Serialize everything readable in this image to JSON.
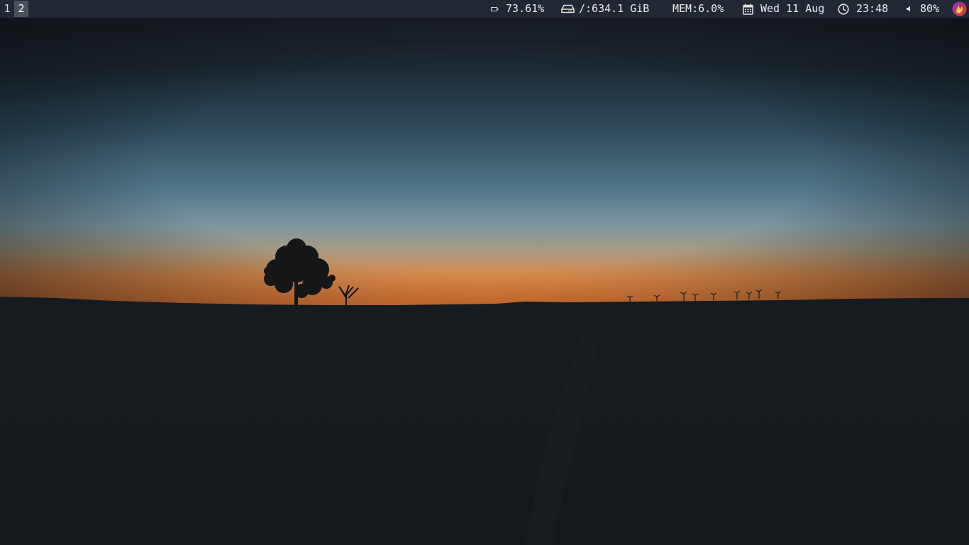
{
  "workspaces": [
    {
      "label": "1",
      "active": false
    },
    {
      "label": "2",
      "active": true
    }
  ],
  "status": {
    "battery": {
      "icon": "battery-icon",
      "value": "73.61%"
    },
    "disk": {
      "icon": "hard-drive-icon",
      "value": "/:634.1 GiB"
    },
    "memory": {
      "value": "MEM:6.0%"
    },
    "date": {
      "icon": "calendar-icon",
      "value": "Wed 11 Aug"
    },
    "time": {
      "icon": "clock-icon",
      "value": "23:48"
    },
    "volume": {
      "icon": "speaker-icon",
      "value": "80%"
    },
    "tray": {
      "icon": "app-tray-icon"
    }
  },
  "colors": {
    "bar_bg": "#222833",
    "bar_text": "#e8e8e8",
    "active_workspace_bg": "#4a505c",
    "sky_top": "#1b2127",
    "sky_mid": "#4a6e80",
    "horizon_glow": "#e0803a",
    "ground": "#151a1e"
  }
}
